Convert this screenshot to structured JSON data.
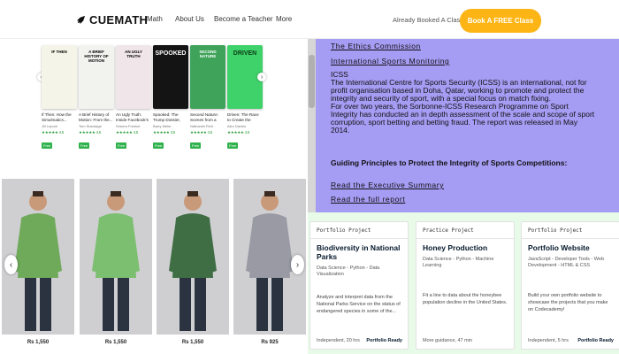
{
  "header": {
    "brand": "CUEMATH",
    "nav": [
      "Math",
      "About Us",
      "Become a Teacher",
      "More"
    ],
    "already_booked": "Already Booked A Class?",
    "cta": "Book A FREE Class"
  },
  "books": [
    {
      "title": "If Then: How the Simulmatics...",
      "author": "Jill Lepore",
      "stars": "★★★★★ 4.5",
      "free": "Free",
      "cover_color": "#f4f4e8",
      "cover_text": "IF THEN"
    },
    {
      "title": "A Brief History of Motion: From the...",
      "author": "Tom Standage",
      "stars": "★★★★★ 4.5",
      "free": "Free",
      "cover_color": "#f2f2ee",
      "cover_text": "A BRIEF HISTORY OF MOTION"
    },
    {
      "title": "An Ugly Truth: Inside Facebook's Battle for...",
      "author": "Sheera Frenkel",
      "stars": "★★★★★ 4.5",
      "free": "Free",
      "cover_color": "#f0e6ea",
      "cover_text": "AN UGLY TRUTH"
    },
    {
      "title": "Spooked: The Trump Dossier, Black Cube,...",
      "author": "Barry Meier",
      "stars": "★★★★★ 3.5",
      "free": "Free",
      "cover_color": "#141414",
      "cover_text": "SPOOKED"
    },
    {
      "title": "Second Nature: Scenes from a World Remade",
      "author": "Nathaniel Rich",
      "stars": "★★★★★ 4.5",
      "free": "Free",
      "cover_color": "#3fa35a",
      "cover_text": "SECOND NATURE"
    },
    {
      "title": "Driven: The Race to Create the Autonomo...",
      "author": "Alex Davies",
      "stars": "★★★★★ 4.5",
      "free": "Free",
      "cover_color": "#3fd16a",
      "cover_text": "DRIVEN"
    }
  ],
  "products": [
    {
      "price": "Rs 1,550",
      "shirt_color": "#6faa5a"
    },
    {
      "price": "Rs 1,550",
      "shirt_color": "#7cbf70"
    },
    {
      "price": "Rs 1,550",
      "shirt_color": "#3f6e45"
    },
    {
      "price": "Rs 925",
      "shirt_color": "#9a9aa5"
    }
  ],
  "article": {
    "link_top": "The Ethics Commission",
    "link_monitoring": "International Sports Monitoring",
    "body": "ICSS\nThe International Centre for Sports Security (ICSS) is an international, not for profit organisation based in Doha, Qatar, working to promote and protect the integrity and security of sport, with a special focus on match fixing.\nFor over two years, the Sorbonne-ICSS Research Programme on Sport Integrity has conducted an in depth assessment of the scale and scope of sport corruption, sport betting and betting fraud. The report was released in May 2014.",
    "heading": "Guiding Principles to Protect the Integrity of Sports Competitions:",
    "link_summary": "Read the Executive Summary",
    "link_report": "Read the full report"
  },
  "cards": [
    {
      "tag": "Portfolio Project",
      "title": "Biodiversity in National Parks",
      "tech": "Data Science - Python - Data Visualization",
      "desc": "Analyze and interpret data from the National Parks Service on the status of endangered species in some of the...",
      "footer_left": "Independent, 20 hrs",
      "footer_right": "Portfolio Ready"
    },
    {
      "tag": "Practice Project",
      "title": "Honey Production",
      "tech": "Data Science - Python - Machine Learning",
      "desc": "Fit a line to data about the honeybee population decline in the United States.",
      "footer_left": "More guidance, 47 min",
      "footer_right": ""
    },
    {
      "tag": "Portfolio Project",
      "title": "Portfolio Website",
      "tech": "JavaScript - Developer Tools - Web Development - HTML & CSS",
      "desc": "Build your own portfolio website to showcase the projects that you make on Codecademy!",
      "footer_left": "Independent, 5 hrs",
      "footer_right": "Portfolio Ready"
    }
  ]
}
